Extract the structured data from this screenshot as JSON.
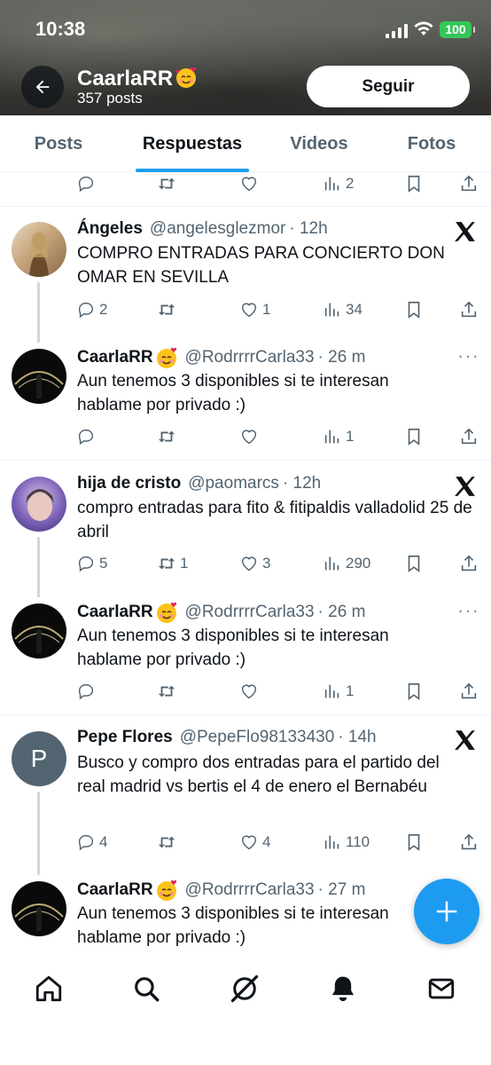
{
  "status_bar": {
    "time": "10:38",
    "battery": "100"
  },
  "profile": {
    "name": "CaarlaRR",
    "posts": "357 posts",
    "follow_label": "Seguir"
  },
  "tabs": [
    {
      "label": "Posts",
      "active": false
    },
    {
      "label": "Respuestas",
      "active": true
    },
    {
      "label": "Videos",
      "active": false
    },
    {
      "label": "Fotos",
      "active": false
    }
  ],
  "top_actions": {
    "replies": "",
    "reposts": "",
    "likes": "",
    "views": "2"
  },
  "tweets": [
    {
      "name": "Ángeles",
      "handle": "@angelesglezmor",
      "time": "· 12h",
      "text": "COMPRO ENTRADAS PARA CONCIERTO DON OMAR EN SEVILLA",
      "replies": "2",
      "reposts": "",
      "likes": "1",
      "views": "34",
      "reply": {
        "name": "CaarlaRR",
        "handle": "@RodrrrrCarla33",
        "time": "· 26 m",
        "text": "Aun tenemos 3 disponibles si te interesan hablame por privado :)",
        "replies": "",
        "reposts": "",
        "likes": "",
        "views": "1"
      }
    },
    {
      "name": "hija de cristo",
      "handle": "@paomarcs",
      "time": "· 12h",
      "text": "compro entradas para fito & fitipaldis valladolid 25 de abril",
      "replies": "5",
      "reposts": "1",
      "likes": "3",
      "views": "290",
      "reply": {
        "name": "CaarlaRR",
        "handle": "@RodrrrrCarla33",
        "time": "· 26 m",
        "text": "Aun tenemos 3 disponibles si te interesan hablame por privado :)",
        "replies": "",
        "reposts": "",
        "likes": "",
        "views": "1"
      }
    },
    {
      "name": "Pepe Flores",
      "handle": "@PepeFlo98133430",
      "time": "· 14h",
      "avatar_letter": "P",
      "text": "Busco y compro dos entradas para el partido del real madrid vs bertis el 4 de enero el Bernabéu",
      "replies": "4",
      "reposts": "",
      "likes": "4",
      "views": "110",
      "reply": {
        "name": "CaarlaRR",
        "handle": "@RodrrrrCarla33",
        "time": "· 27 m",
        "text": "Aun tenemos 3 disponibles si te interesan hablame por privado :)"
      }
    }
  ],
  "colors": {
    "accent": "#1d9bf0",
    "text": "#0f1419",
    "muted": "#536471",
    "divider": "#eff3f4",
    "battery": "#34c759"
  }
}
